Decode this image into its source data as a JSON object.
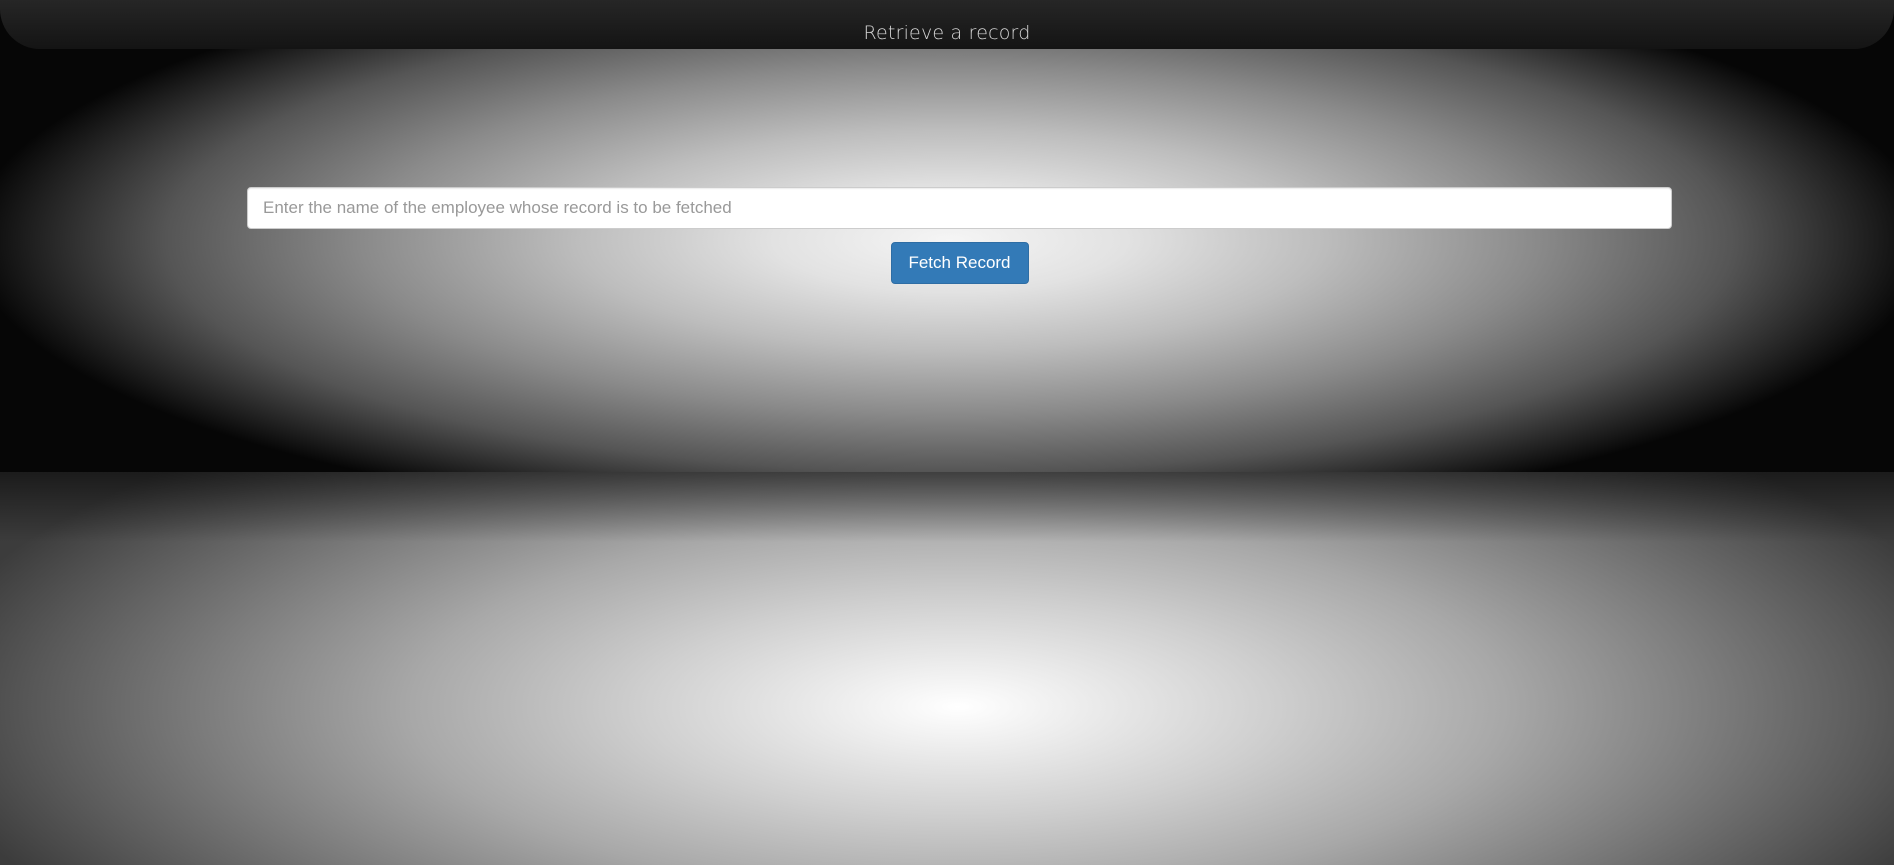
{
  "header": {
    "title": "Retrieve a record"
  },
  "form": {
    "search_placeholder": "Enter the name of the employee whose record is to be fetched",
    "search_value": "",
    "fetch_label": "Fetch Record"
  },
  "colors": {
    "header_bg": "#1a1a1a",
    "button_bg": "#337ab7",
    "button_text": "#ffffff"
  }
}
